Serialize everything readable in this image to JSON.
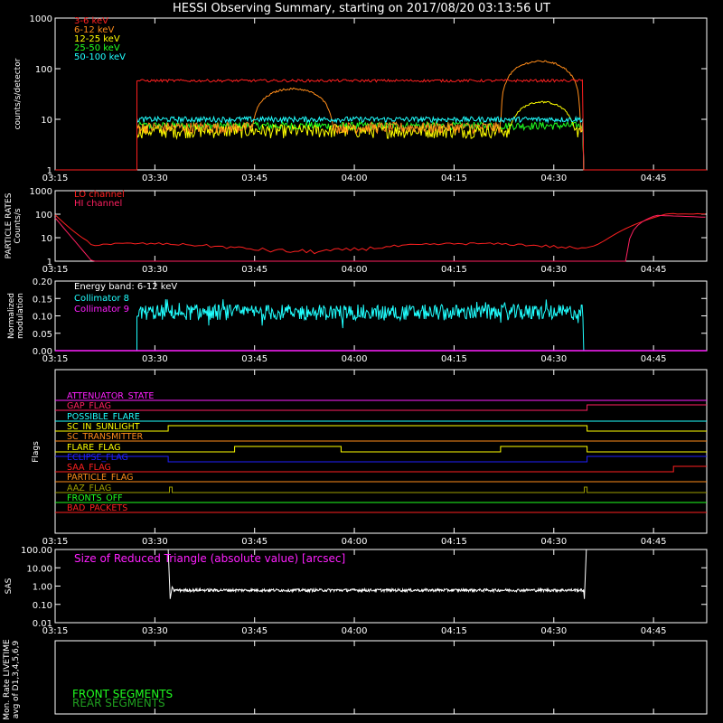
{
  "title": "HESSI Observing Summary, starting on 2017/08/20 03:13:56 UT",
  "time_ticks": [
    "03:15",
    "03:30",
    "03:45",
    "04:00",
    "04:15",
    "04:30",
    "04:45"
  ],
  "colors": {
    "background": "#000000",
    "axes": "#ffffff",
    "red": "#ff2020",
    "orange": "#ff8c1a",
    "yellow": "#ffff00",
    "green": "#20ff20",
    "cyan": "#20ffff",
    "magenta": "#ff20ff",
    "crimson": "#ff2060"
  },
  "chart_data": [
    {
      "id": "counts",
      "type": "line",
      "ylabel": "counts/s/detector",
      "yscale": "log",
      "ylim": [
        1,
        1000
      ],
      "y_ticks": [
        "1",
        "10",
        "100",
        "1000"
      ],
      "x_range_min": [
        0,
        98
      ],
      "series": [
        {
          "name": "3-6 keV",
          "color": "#ff2020"
        },
        {
          "name": "6-12 keV",
          "color": "#ff8c1a"
        },
        {
          "name": "12-25 keV",
          "color": "#ffff00"
        },
        {
          "name": "25-50 keV",
          "color": "#20ff20"
        },
        {
          "name": "50-100 keV",
          "color": "#20ffff"
        }
      ]
    },
    {
      "id": "particle",
      "type": "line",
      "ylabel": "PARTICLE RATES Counts/s",
      "yscale": "log",
      "ylim": [
        1,
        1000
      ],
      "y_ticks": [
        "1",
        "10",
        "100",
        "1000"
      ],
      "series": [
        {
          "name": "LO channel",
          "color": "#ff2020"
        },
        {
          "name": "HI channel",
          "color": "#ff2060"
        }
      ]
    },
    {
      "id": "modulation",
      "type": "line",
      "ylabel": "Normalized modulation",
      "ylim": [
        0,
        0.2
      ],
      "y_ticks": [
        "0.00",
        "0.05",
        "0.10",
        "0.15",
        "0.20"
      ],
      "energy_band": "Energy band: 6-12 keV",
      "series": [
        {
          "name": "Collimator 8",
          "color": "#20ffff"
        },
        {
          "name": "Collimator 9",
          "color": "#ff20ff"
        }
      ]
    },
    {
      "id": "flags",
      "type": "line",
      "ylabel": "Flags",
      "flags": [
        {
          "name": "ATTENUATOR_STATE",
          "color": "#ff20ff"
        },
        {
          "name": "GAP_FLAG",
          "color": "#ff2060"
        },
        {
          "name": "POSSIBLE_FLARE",
          "color": "#20ffff"
        },
        {
          "name": "SC_IN_SUNLIGHT",
          "color": "#ffff00"
        },
        {
          "name": "SC_TRANSMITTER",
          "color": "#ff8c1a"
        },
        {
          "name": "FLARE_FLAG",
          "color": "#ffff00"
        },
        {
          "name": "ECLIPSE_FLAG",
          "color": "#2020ff"
        },
        {
          "name": "SAA_FLAG",
          "color": "#ff2020"
        },
        {
          "name": "PARTICLE_FLAG",
          "color": "#ff8c1a"
        },
        {
          "name": "AAZ_FLAG",
          "color": "#a0a000"
        },
        {
          "name": "FRONTS_OFF",
          "color": "#20ff20"
        },
        {
          "name": "BAD_PACKETS",
          "color": "#ff2020"
        }
      ]
    },
    {
      "id": "sas",
      "type": "line",
      "ylabel": "SAS",
      "yscale": "log",
      "ylim": [
        0.01,
        100
      ],
      "y_ticks": [
        "0.01",
        "0.10",
        "1.00",
        "10.00",
        "100.00"
      ],
      "annotation": "Size of Reduced Triangle (absolute value) [arcsec]",
      "annotation_color": "#ff20ff"
    },
    {
      "id": "livetime",
      "type": "line",
      "ylabel": "Mon. Rate LIVETIME avg of D1,3,4,5,6,9",
      "series": [
        {
          "name": "FRONT SEGMENTS",
          "color": "#20ff20"
        },
        {
          "name": "REAR SEGMENTS",
          "color": "#20a020"
        }
      ]
    }
  ]
}
